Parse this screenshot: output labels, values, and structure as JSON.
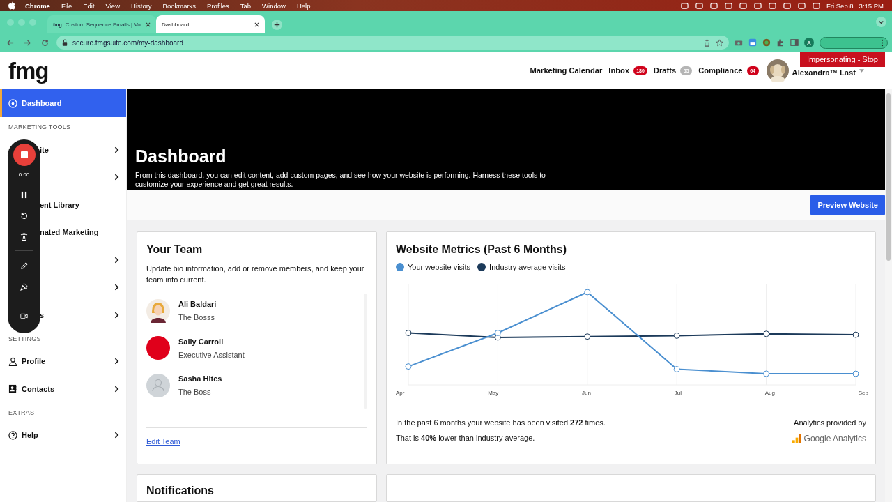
{
  "menu_bar": {
    "app": "Chrome",
    "items": [
      "File",
      "Edit",
      "View",
      "History",
      "Bookmarks",
      "Profiles",
      "Tab",
      "Window",
      "Help"
    ],
    "date": "Fri Sep 8",
    "time": "3:15 PM"
  },
  "browser": {
    "tabs": [
      {
        "title": "Custom Sequence Emails | Vo",
        "favicon": "fmg",
        "selected": false
      },
      {
        "title": "Dashboard",
        "selected": true
      }
    ],
    "url": "secure.fmgsuite.com/my-dashboard",
    "profile": "A"
  },
  "header": {
    "logo": "fmg",
    "nav": [
      {
        "label": "Marketing Calendar"
      },
      {
        "label": "Inbox",
        "badge": "180",
        "color": "#d0021b"
      },
      {
        "label": "Drafts",
        "badge": "55",
        "color": "#b5b5b5"
      },
      {
        "label": "Compliance",
        "badge": "64",
        "color": "#d0021b"
      }
    ],
    "user": "Alexandra™ Last",
    "impersonating": {
      "text": "Impersonating - ",
      "link": "Stop"
    }
  },
  "sidebar": {
    "items": [
      {
        "kind": "item",
        "label": "Dashboard",
        "selected": true,
        "chevron": false
      },
      {
        "kind": "header",
        "label": "MARKETING TOOLS"
      },
      {
        "kind": "item",
        "label": "ite",
        "covered": true,
        "selected": false,
        "chevron": true
      },
      {
        "kind": "item",
        "covered": true,
        "selected": false,
        "chevron": true
      },
      {
        "kind": "item",
        "label": "ent Library",
        "covered": true,
        "selected": false,
        "chevron": false
      },
      {
        "kind": "item",
        "label": "nated Marketing",
        "covered": true,
        "selected": false,
        "chevron": false
      },
      {
        "kind": "item",
        "covered": true,
        "selected": false,
        "chevron": true
      },
      {
        "kind": "item",
        "covered": true,
        "selected": false,
        "chevron": true
      },
      {
        "kind": "item",
        "label": "s",
        "covered": true,
        "selected": false,
        "chevron": true
      },
      {
        "kind": "header",
        "label": "SETTINGS"
      },
      {
        "kind": "item",
        "label": "Profile",
        "selected": false,
        "chevron": true
      },
      {
        "kind": "item",
        "label": "Contacts",
        "selected": false,
        "chevron": true
      },
      {
        "kind": "header",
        "label": "EXTRAS"
      },
      {
        "kind": "item",
        "label": "Help",
        "selected": false,
        "chevron": true
      }
    ]
  },
  "recorder": {
    "time": "0:00"
  },
  "hero": {
    "title": "Dashboard",
    "description": "From this dashboard, you can edit content, add custom pages, and see how your website is performing. Harness these tools to customize your experience and get great results."
  },
  "preview_button": "Preview Website",
  "team": {
    "title": "Your Team",
    "description": "Update bio information, add or remove members, and keep your team info current.",
    "members": [
      {
        "name": "Ali Baldari",
        "role": "The Bosss",
        "kind": "illustration"
      },
      {
        "name": "Sally Carroll",
        "role": "Executive Assistant",
        "kind": "color",
        "color": "#e0001b"
      },
      {
        "name": "Sasha Hites",
        "role": "The Boss",
        "kind": "placeholder"
      }
    ],
    "edit_link": "Edit Team"
  },
  "metrics": {
    "title": "Website Metrics (Past 6 Months)",
    "legend": [
      {
        "label": "Your website visits",
        "color": "#4a8fd0"
      },
      {
        "label": "Industry average visits",
        "color": "#1c3a5a"
      }
    ],
    "months": [
      "Apr",
      "May",
      "Jun",
      "Jul",
      "Aug",
      "Sep"
    ],
    "summary": "In the past 6 months your website has been visited **272** times.",
    "comparison": "That is **40%** lower than industry average.",
    "provider_label": "Analytics provided by",
    "provider": "Google Analytics"
  },
  "notifications": {
    "title": "Notifications"
  }
}
